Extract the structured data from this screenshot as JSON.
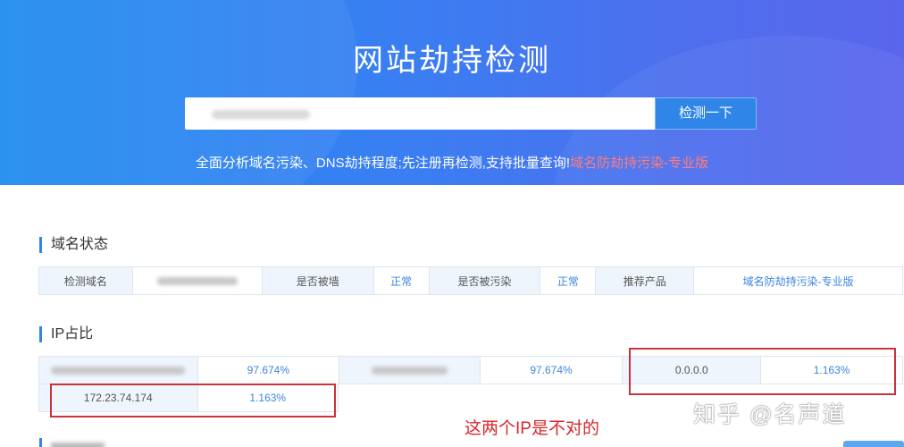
{
  "banner": {
    "title": "网站劫持检测",
    "search_value": "",
    "search_button": "检测一下",
    "subtitle_main": "全面分析域名污染、DNS劫持程度;先注册再检测,支持批量查询!",
    "subtitle_link": "域名防劫持污染-专业版"
  },
  "domain_status": {
    "section_title": "域名状态",
    "cells": {
      "domain_label": "检测域名",
      "blocked_label": "是否被墙",
      "blocked_value": "正常",
      "polluted_label": "是否被污染",
      "polluted_value": "正常",
      "product_label": "推荐产品",
      "product_link": "域名防劫持污染-专业版"
    }
  },
  "ip_share": {
    "section_title": "IP占比",
    "rows": [
      [
        {
          "ip": "",
          "pct": "97.674%"
        },
        {
          "ip": "",
          "pct": "97.674%"
        },
        {
          "ip": "0.0.0.0",
          "pct": "1.163%"
        }
      ],
      [
        {
          "ip": "172.23.74.174",
          "pct": "1.163%"
        }
      ]
    ]
  },
  "annotation": "这两个IP是不对的",
  "watermark": "知乎 @名声道",
  "colors": {
    "accent": "#2f86e8",
    "link": "#3b86e0",
    "annotation_red": "#d9262c"
  }
}
